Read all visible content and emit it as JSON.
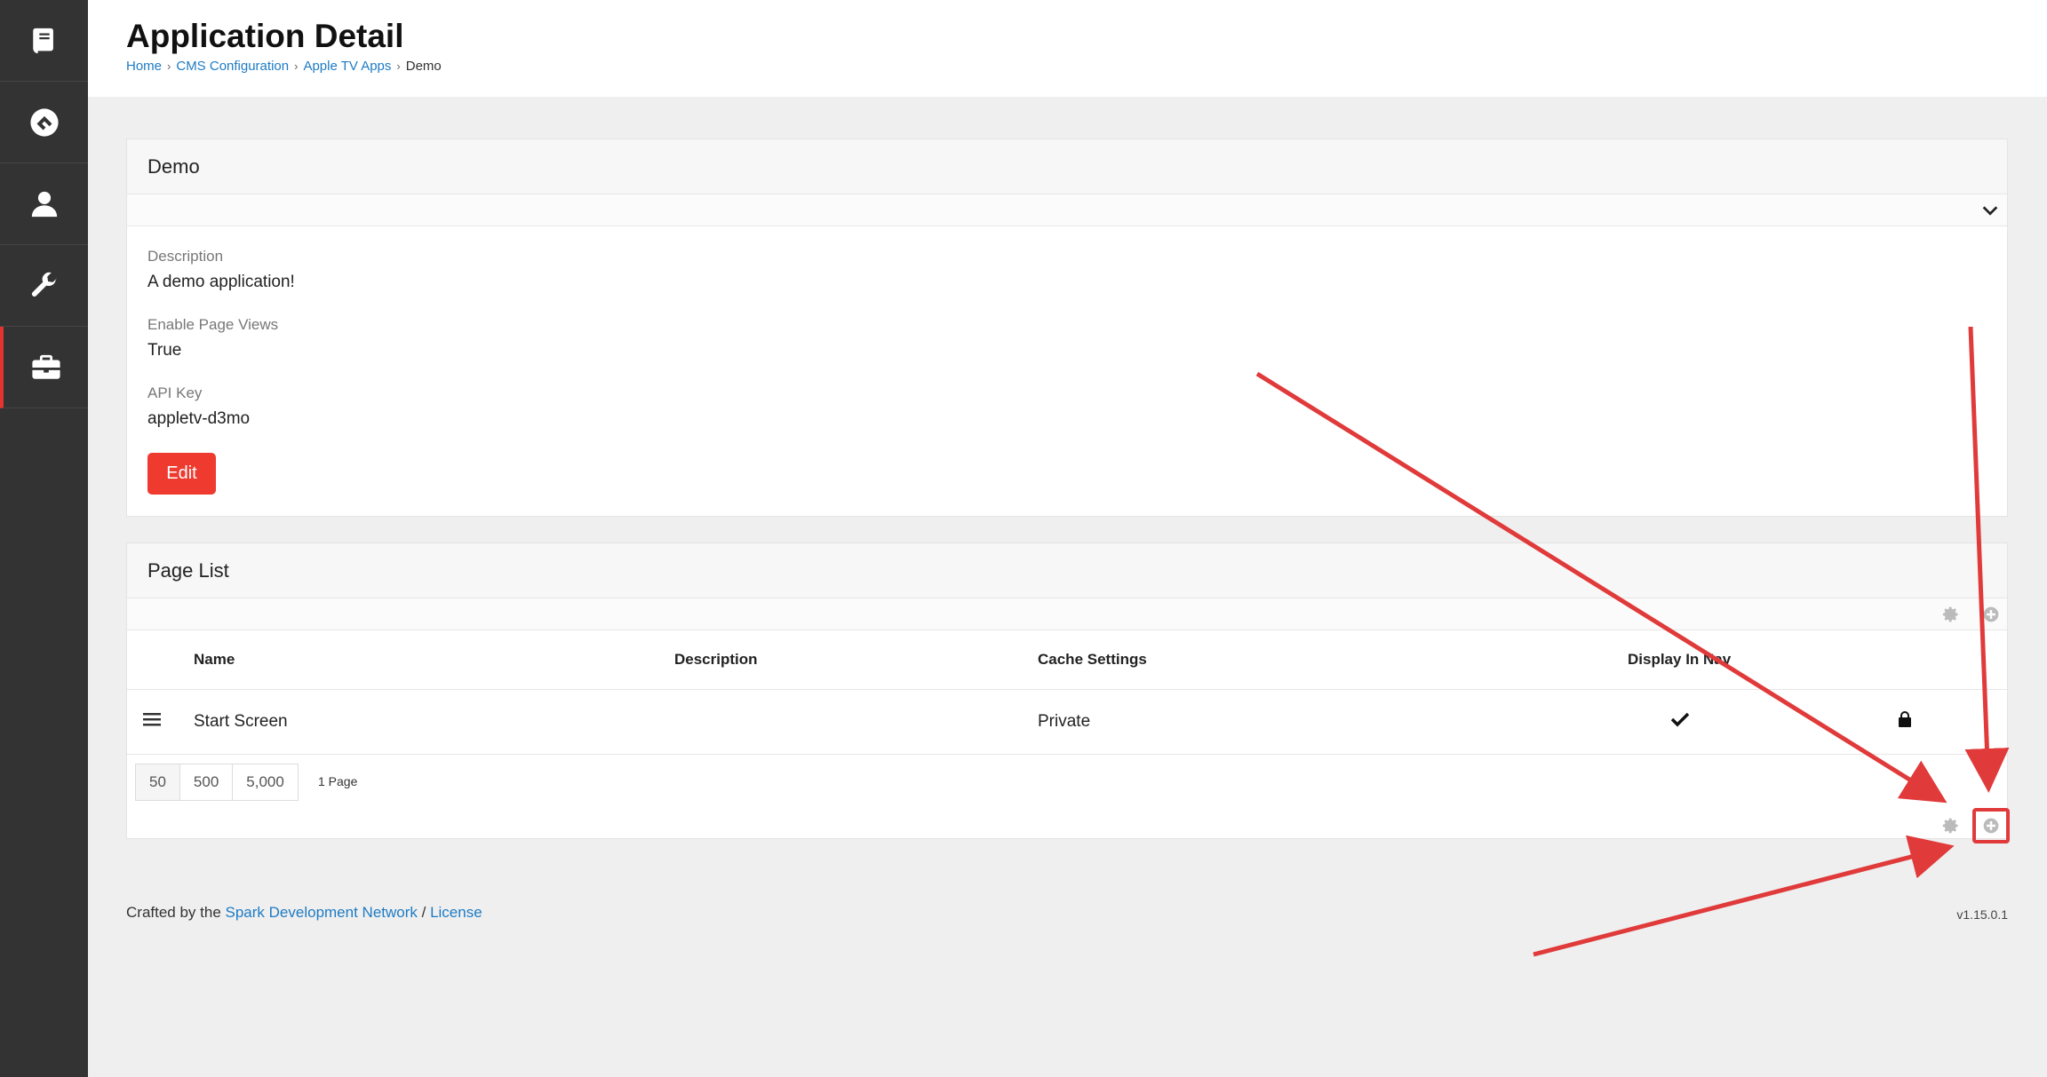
{
  "sidebar": {
    "items": [
      {
        "icon": "book-icon",
        "name": "sidebar-item-content"
      },
      {
        "icon": "rock-logo-icon",
        "name": "sidebar-item-home"
      },
      {
        "icon": "user-icon",
        "name": "sidebar-item-people"
      },
      {
        "icon": "wrench-icon",
        "name": "sidebar-item-tools"
      },
      {
        "icon": "briefcase-icon",
        "name": "sidebar-item-admin",
        "active": true
      }
    ],
    "active_color": "#e3342f"
  },
  "header": {
    "title": "Application Detail",
    "breadcrumb": [
      "Home",
      "CMS Configuration",
      "Apple TV Apps",
      "Demo"
    ]
  },
  "detail_panel": {
    "title": "Demo",
    "fields": [
      {
        "label": "Description",
        "value": "A demo application!"
      },
      {
        "label": "Enable Page Views",
        "value": "True"
      },
      {
        "label": "API Key",
        "value": "appletv-d3mo"
      }
    ],
    "edit_label": "Edit"
  },
  "page_list": {
    "title": "Page List",
    "columns": [
      "Name",
      "Description",
      "Cache Settings",
      "Display In Nav"
    ],
    "rows": [
      {
        "name": "Start Screen",
        "description": "",
        "cache": "Private",
        "display_in_nav": true,
        "locked": true
      }
    ],
    "page_sizes": [
      "50",
      "500",
      "5,000"
    ],
    "page_count": "1 Page"
  },
  "footer": {
    "prefix": "Crafted by the ",
    "link1": "Spark Development Network",
    "sep": " / ",
    "link2": "License",
    "version": "v1.15.0.1"
  },
  "colors": {
    "accent": "#ee3a2f",
    "link": "#1e7bc4",
    "annotation": "#e03a3a"
  }
}
